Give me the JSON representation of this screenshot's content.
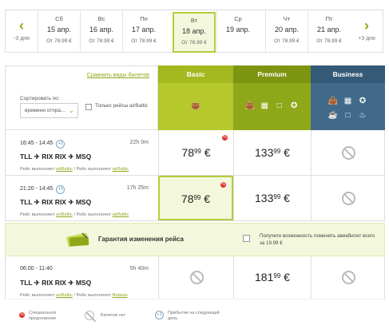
{
  "dates": {
    "prev_label": "-3 дня",
    "next_label": "+3 дня",
    "days": [
      {
        "weekday": "Сб",
        "date": "15 апр.",
        "price": "От 78.99 €",
        "selected": false
      },
      {
        "weekday": "Вс",
        "date": "16 апр.",
        "price": "От 78.99 €",
        "selected": false
      },
      {
        "weekday": "Пн",
        "date": "17 апр.",
        "price": "От 78.99 €",
        "selected": false
      },
      {
        "weekday": "Вт",
        "date": "18 апр.",
        "price": "От 78.99 €",
        "selected": true
      },
      {
        "weekday": "Ср",
        "date": "19 апр.",
        "price": "",
        "selected": false
      },
      {
        "weekday": "Чт",
        "date": "20 апр.",
        "price": "От 78.99 €",
        "selected": false
      },
      {
        "weekday": "Пт",
        "date": "21 апр.",
        "price": "От 78.99 €",
        "selected": false
      }
    ]
  },
  "header": {
    "compare_link": "Сравнить виды билетов",
    "sort_label": "Сортировать по:",
    "sort_value": "времени отпра...",
    "airbaltic_only": "Только рейсы airBaltic",
    "fares": [
      "Basic",
      "Premium",
      "Business"
    ]
  },
  "flights": [
    {
      "time": "16:45 - 14:45",
      "plus": "+1",
      "duration": "22h 0m",
      "route": "TLL ✈ RIX   RIX ✈ MSQ",
      "operator_prefix1": "Рейс выполняет ",
      "operator1": "airBaltic",
      "operator_prefix2": " / Рейс выполняет ",
      "operator2": "airBaltic",
      "basic_int": "78",
      "basic_dec": "99",
      "premium_int": "133",
      "premium_dec": "99",
      "currency": "€"
    },
    {
      "time": "21:20 - 14:45",
      "plus": "+1",
      "duration": "17h 25m",
      "route": "TLL ✈ RIX   RIX ✈ MSQ",
      "operator_prefix1": "Рейс выполняет ",
      "operator1": "airBaltic",
      "operator_prefix2": " / Рейс выполняет ",
      "operator2": "airBaltic",
      "basic_int": "78",
      "basic_dec": "99",
      "premium_int": "133",
      "premium_dec": "99",
      "currency": "€"
    },
    {
      "time": "06:00 - 11:40",
      "plus": "",
      "duration": "5h 40m",
      "route": "TLL ✈ RIX   RIX ✈ MSQ",
      "operator_prefix1": "Рейс выполняет ",
      "operator1": "airBaltic",
      "operator_prefix2": " / Рейс выполняет ",
      "operator2": "Belavia",
      "premium_int": "181",
      "premium_dec": "99",
      "currency": "€"
    }
  ],
  "guarantee": {
    "title": "Гарантия изменения рейса",
    "desc": "Получите возможность поменять авиабилет всего за 19.99 €"
  },
  "legend": {
    "special": "Специальное предложение",
    "no_tickets": "Билетов нет",
    "next_day": "Прибытие на следующий день"
  },
  "colors": {
    "accent": "#8fa81a",
    "basic": "#b5c82c",
    "premium": "#8fa81a",
    "business": "#416a8a"
  }
}
